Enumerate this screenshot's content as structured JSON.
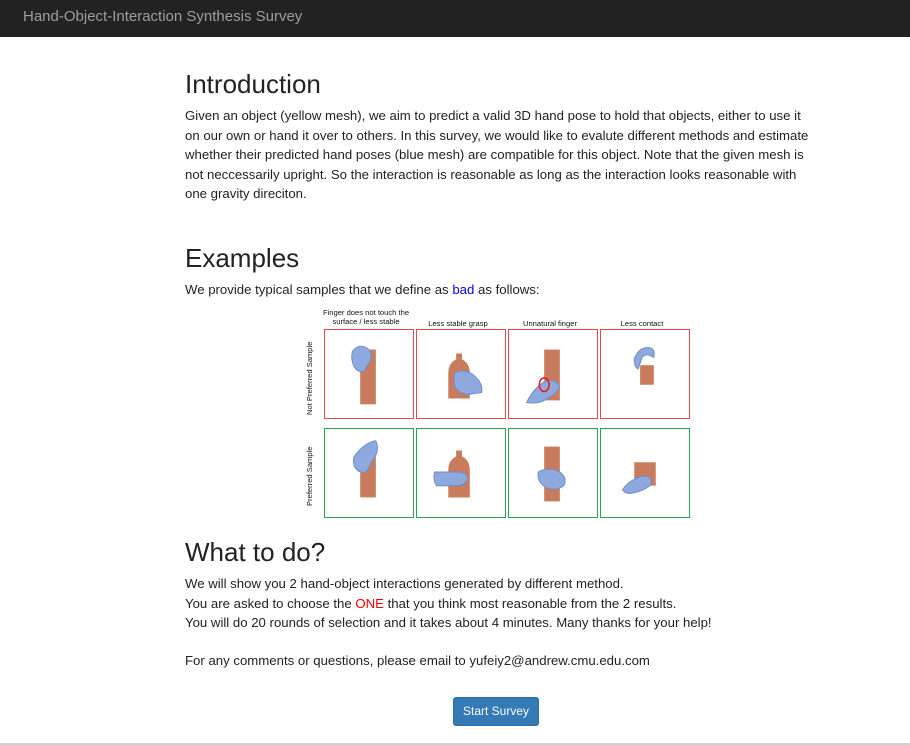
{
  "navbar": {
    "brand": "Hand-Object-Interaction Synthesis Survey"
  },
  "intro": {
    "title": "Introduction",
    "text": "Given an object (yellow mesh), we aim to predict a valid 3D hand pose to hold that objects, either to use it on our own or hand it over to others. In this survey, we would like to evalute different methods and estimate whether their predicted hand poses (blue mesh) are compatible for this object. Note that the given mesh is not neccessarily upright. So the interaction is reasonable as long as the interaction looks reasonable with one gravity direciton."
  },
  "examples": {
    "title": "Examples",
    "text_before": "We provide typical samples that we define as ",
    "highlight": "bad",
    "text_after": " as follows:",
    "figure": {
      "column_labels": [
        "Finger does not touch the surface / less stable",
        "Less stable grasp",
        "Unnatural finger",
        "Less contact"
      ],
      "row_labels": [
        "Not Preferred Sample",
        "Preferred Sample"
      ]
    }
  },
  "todo": {
    "title": "What to do?",
    "line1": "We will show you 2 hand-object interactions generated by different method.",
    "line2_before": "You are asked to choose the ",
    "line2_highlight": "ONE",
    "line2_after": " that you think most reasonable from the 2 results.",
    "line3": "You will do 20 rounds of selection and it takes about 4 minutes. Many thanks for your help!",
    "contact": "For any comments or questions, please email to yufeiy2@andrew.cmu.edu.com"
  },
  "start_button": {
    "label": "Start Survey"
  },
  "colors": {
    "navbar_bg": "#222222",
    "brand_text": "#9d9d9d",
    "highlight_blue": "#0000ee",
    "highlight_red": "#ff0000",
    "not_preferred_border": "#e14b4b",
    "preferred_border": "#2aa34a",
    "button_bg": "#337ab7",
    "object_mesh": "#c97b5e",
    "hand_mesh": "#8ea9dd"
  }
}
